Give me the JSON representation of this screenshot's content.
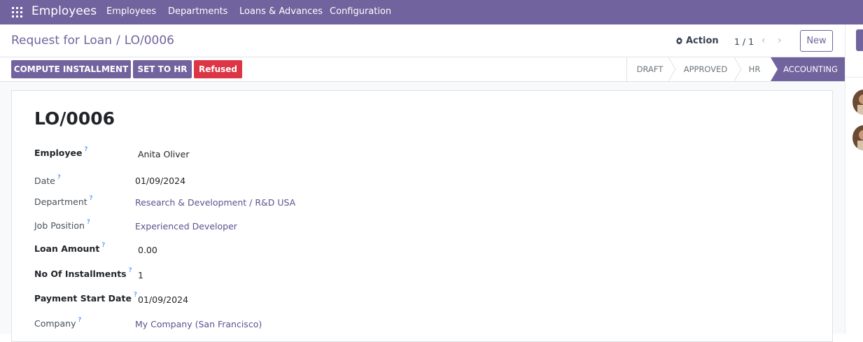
{
  "navbar": {
    "app_name": "Employees",
    "menus": [
      "Employees",
      "Departments",
      "Loans & Advances",
      "Configuration"
    ]
  },
  "breadcrumb": {
    "parent": "Request for Loan",
    "separator": "/",
    "current": "LO/0006"
  },
  "control": {
    "action_label": "Action",
    "pager": "1 / 1",
    "new_label": "New"
  },
  "buttons": {
    "compute": "COMPUTE INSTALLMENT",
    "set_to_hr": "SET TO HR",
    "refused": "Refused"
  },
  "stages": [
    "DRAFT",
    "APPROVED",
    "HR",
    "ACCOUNTING"
  ],
  "active_stage": "ACCOUNTING",
  "record": {
    "title": "LO/0006",
    "fields": {
      "employee": {
        "label": "Employee",
        "value": "Anita Oliver"
      },
      "date": {
        "label": "Date",
        "value": "01/09/2024"
      },
      "department": {
        "label": "Department",
        "value": "Research & Development / R&D USA"
      },
      "job_position": {
        "label": "Job Position",
        "value": "Experienced Developer"
      },
      "loan_amount": {
        "label": "Loan Amount",
        "value": "0.00"
      },
      "installments": {
        "label": "No Of Installments",
        "value": "1"
      },
      "payment_start": {
        "label": "Payment Start Date",
        "value": "01/09/2024"
      },
      "company": {
        "label": "Company",
        "value": "My Company (San Francisco)"
      }
    },
    "help_mark": "?"
  },
  "colors": {
    "brand": "#71639e",
    "danger": "#dc3545",
    "link": "#5d518f"
  }
}
